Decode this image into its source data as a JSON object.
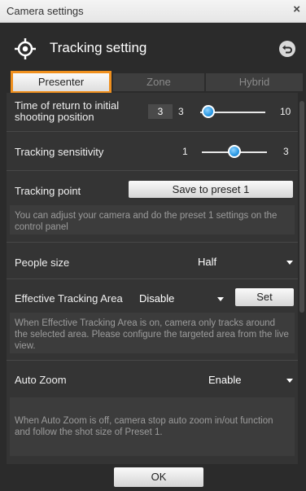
{
  "window": {
    "title": "Camera settings",
    "close_glyph": "×"
  },
  "header": {
    "title": "Tracking setting",
    "icon": "crosshair-target-icon",
    "back_icon": "undo-arrow-icon"
  },
  "tabs": [
    {
      "label": "Presenter",
      "active": true
    },
    {
      "label": "Zone",
      "active": false
    },
    {
      "label": "Hybrid",
      "active": false
    }
  ],
  "return_time": {
    "label_line1": "Time of return to initial",
    "label_line2": "shooting position",
    "current_value": "3",
    "min": "3",
    "max": "10",
    "slider_fraction": 0.0
  },
  "sensitivity": {
    "label": "Tracking sensitivity",
    "min": "1",
    "max": "3",
    "slider_fraction": 0.5
  },
  "tracking_point": {
    "label": "Tracking point",
    "button_label": "Save to preset 1",
    "note": "You can adjust your camera and do the preset 1 settings on the control panel"
  },
  "people_size": {
    "label": "People size",
    "value": "Half"
  },
  "effective_area": {
    "label": "Effective Tracking Area",
    "value": "Disable",
    "button_label": "Set",
    "note": "When Effective Tracking Area is on, camera only tracks around the selected area. Please configure the targeted area from the live view."
  },
  "auto_zoom": {
    "label": "Auto Zoom",
    "value": "Enable",
    "note": "When Auto Zoom is off, camera stop auto zoom in/out function and follow the shot size of Preset 1."
  },
  "footer": {
    "ok_label": "OK"
  },
  "colors": {
    "accent_tab_border": "#f0901e",
    "slider_knob": "#2a98e3",
    "background": "#2b2b2b"
  }
}
